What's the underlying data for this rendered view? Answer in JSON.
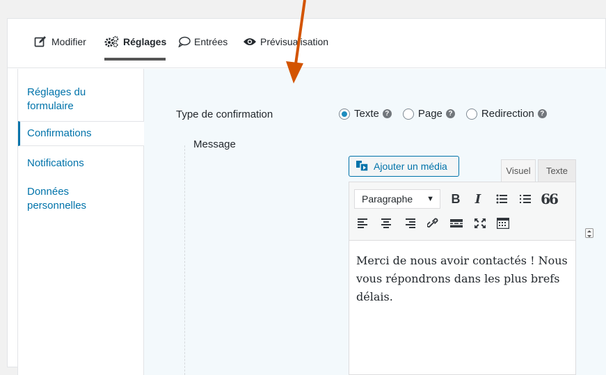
{
  "tabs": [
    {
      "label": "Modifier",
      "icon": "edit-icon"
    },
    {
      "label": "Réglages",
      "icon": "gears-icon",
      "active": true
    },
    {
      "label": "Entrées",
      "icon": "speech-bubble-icon"
    },
    {
      "label": "Prévisualisation",
      "icon": "eye-icon"
    }
  ],
  "sidebar": {
    "items": [
      {
        "label_line1": "Réglages du",
        "label_line2": "formulaire"
      },
      {
        "label": "Confirmations",
        "active": true
      },
      {
        "label": "Notifications"
      },
      {
        "label_line1": "Données",
        "label_line2": "personnelles"
      }
    ]
  },
  "settings": {
    "confirmation_type_label": "Type de confirmation",
    "options": [
      {
        "label": "Texte",
        "checked": true
      },
      {
        "label": "Page"
      },
      {
        "label": "Redirection"
      }
    ],
    "message_label": "Message"
  },
  "editor": {
    "add_media_label": "Ajouter un média",
    "tab_visual": "Visuel",
    "tab_text": "Texte",
    "format_select_value": "Paragraphe",
    "content_lines": [
      "Merci de nous avoir contactés ! Nous",
      "vous répondrons dans les plus brefs",
      "délais."
    ],
    "toolbar": {
      "bold": "B",
      "italic": "I",
      "blockquote": "66"
    }
  },
  "colors": {
    "accent": "#0073aa",
    "annotation_arrow": "#d35400",
    "radio_checked": "#1e8cbe"
  }
}
